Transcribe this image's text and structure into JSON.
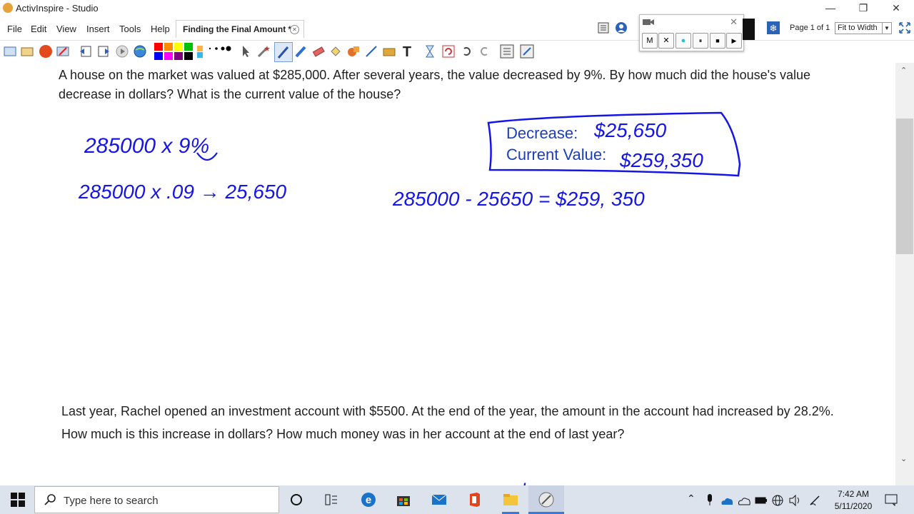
{
  "window": {
    "title": "ActivInspire - Studio"
  },
  "menu": {
    "items": [
      "File",
      "Edit",
      "View",
      "Insert",
      "Tools",
      "Help"
    ]
  },
  "document_tab": {
    "label": "Finding the Final Amount *"
  },
  "page_nav": {
    "label": "Page 1 of 1",
    "zoom": "Fit to Width"
  },
  "recorder": {
    "buttons": [
      "M",
      "✕",
      "●",
      "⏸",
      "■",
      "▶"
    ]
  },
  "questions": {
    "q1": "A house on the market was valued at $285,000. After several years, the value decreased by 9%. By how much did the house's value decrease in dollars? What is the current value of the house?",
    "q2": "Last year, Rachel opened an investment account with $5500. At the end of the year, the amount in the account had increased by 28.2%. How much is this increase in dollars? How much money was in her account at the end of last year?"
  },
  "annotations": {
    "work_line1": "285000 x 9%",
    "work_line2": "285000 x .09 → 25,650",
    "work_line3": "285000 - 25650 = $259, 350",
    "answer_box": {
      "decrease_label": "Decrease:",
      "decrease_value": "$25,650",
      "current_label": "Current Value:",
      "current_value": "$259,350"
    },
    "partial_label": "Increase:"
  },
  "taskbar": {
    "search_placeholder": "Type here to search",
    "time": "7:42 AM",
    "date": "5/11/2020"
  },
  "colors": {
    "ink": "#1515e6",
    "text": "#1f1f1f",
    "taskbar": "#dde3ec"
  }
}
